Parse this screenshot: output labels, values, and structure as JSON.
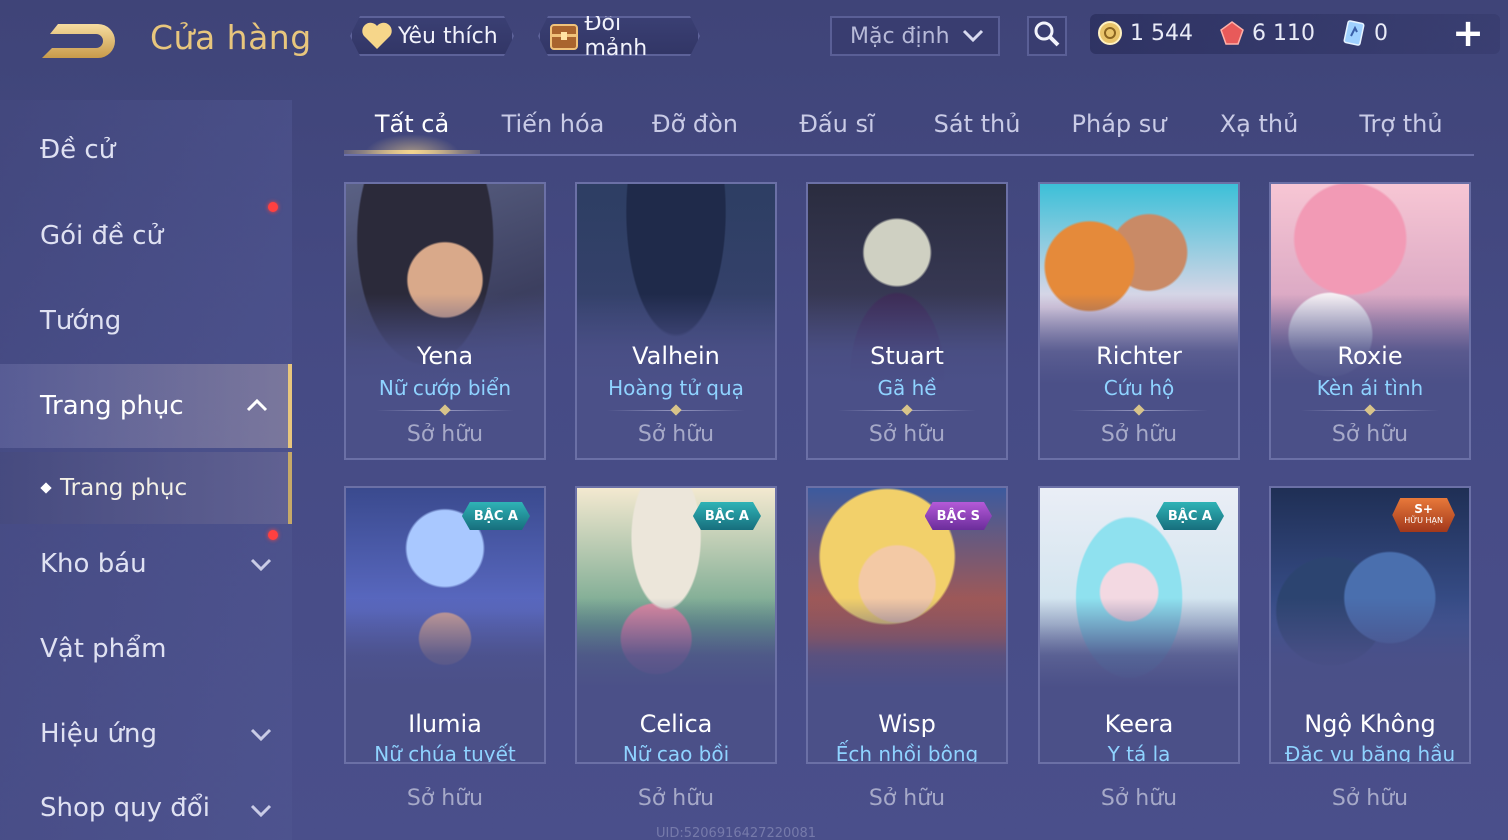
{
  "header": {
    "title": "Cửa hàng",
    "favorites_label": "Yêu thích",
    "exchange_label": "Đổi mảnh",
    "sort_value": "Mặc định",
    "currencies": [
      {
        "name": "gold-coin",
        "value": "1 544",
        "color": "#e9c46a"
      },
      {
        "name": "ruby",
        "value": "6 110",
        "color": "#e85a5a"
      },
      {
        "name": "voucher",
        "value": "0",
        "color": "#7fb6ff"
      }
    ],
    "add_label": "+"
  },
  "sidebar": {
    "items": [
      {
        "label": "Đề cử"
      },
      {
        "label": "Gói đề cử"
      },
      {
        "label": "Tướng"
      },
      {
        "label": "Trang phục"
      },
      {
        "label": "Kho báu"
      },
      {
        "label": "Vật phẩm"
      },
      {
        "label": "Hiệu ứng"
      },
      {
        "label": "Shop quy đổi"
      }
    ],
    "sub_item": "Trang phục"
  },
  "tabs": [
    "Tất cả",
    "Tiến hóa",
    "Đỡ đòn",
    "Đấu sĩ",
    "Sát thủ",
    "Pháp sư",
    "Xạ thủ",
    "Trợ thủ"
  ],
  "cards": [
    {
      "hero": "Yena",
      "skin": "Nữ cướp biển",
      "status": "Sở hữu",
      "badge": ""
    },
    {
      "hero": "Valhein",
      "skin": "Hoàng tử quạ",
      "status": "Sở hữu",
      "badge": ""
    },
    {
      "hero": "Stuart",
      "skin": "Gã hề",
      "status": "Sở hữu",
      "badge": ""
    },
    {
      "hero": "Richter",
      "skin": "Cứu hộ",
      "status": "Sở hữu",
      "badge": ""
    },
    {
      "hero": "Roxie",
      "skin": "Kèn ái tình",
      "status": "Sở hữu",
      "badge": ""
    },
    {
      "hero": "Ilumia",
      "skin": "Nữ chúa tuyết",
      "status": "Sở hữu",
      "badge": "BẬC A"
    },
    {
      "hero": "Celica",
      "skin": "Nữ cao bồi",
      "status": "Sở hữu",
      "badge": "BẬC A"
    },
    {
      "hero": "Wisp",
      "skin": "Ếch nhồi bông",
      "status": "Sở hữu",
      "badge": "BẬC S"
    },
    {
      "hero": "Keera",
      "skin": "Y tá lạ",
      "status": "Sở hữu",
      "badge": "BẬC A"
    },
    {
      "hero": "Ngộ Không",
      "skin": "Đặc vụ băng hầu",
      "status": "Sở hữu",
      "badge": "S+",
      "badge_sub": "HỮU HẠN"
    }
  ],
  "footer": {
    "uid": "UID:5206916427220081"
  }
}
